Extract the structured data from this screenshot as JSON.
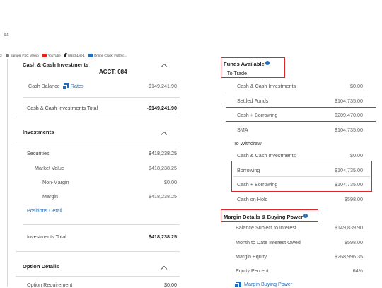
{
  "browser": {
    "top_mark": "L5",
    "bookmark_prefix": "3",
    "bookmarks": [
      {
        "label": "Sample FSC Memo",
        "icon": "globe-icon"
      },
      {
        "label": "YouTube",
        "icon": "youtube-icon"
      },
      {
        "label": "WatchList-1",
        "icon": "watchlist-icon"
      },
      {
        "label": "Online Clock: Full Sc...",
        "icon": "clock-icon"
      }
    ]
  },
  "left": {
    "cash": {
      "title": "Cash & Cash Investments",
      "account": "ACCT: 084",
      "balance_label": "Cash Balance",
      "rates_label": "Rates",
      "balance_value": "-$149,241.90",
      "total_label": "Cash & Cash Investments Total",
      "total_value": "-$149,241.90"
    },
    "investments": {
      "title": "Investments",
      "securities_label": "Securities",
      "securities_value": "$418,238.25",
      "market_value_label": "Market Value",
      "market_value_value": "$418,238.25",
      "non_margin_label": "Non-Margin",
      "non_margin_value": "$0.00",
      "margin_label": "Margin",
      "margin_value": "$418,238.25",
      "positions_detail": "Positions Detail",
      "total_label": "Investments Total",
      "total_value": "$418,238.25"
    },
    "options": {
      "title": "Option Details",
      "requirement_label": "Option Requirement",
      "requirement_value": "$0.00"
    }
  },
  "right": {
    "funds": {
      "title": "Funds Available",
      "to_trade": "To Trade",
      "rows": [
        {
          "label": "Cash & Cash Investments",
          "value": "$0.00"
        },
        {
          "label": "Settled Funds",
          "value": "$104,735.00"
        },
        {
          "label": "Cash + Borrowing",
          "value": "$209,470.00"
        },
        {
          "label": "SMA",
          "value": "$104,735.00"
        }
      ],
      "to_withdraw": "To Withdraw",
      "withdraw_rows": [
        {
          "label": "Cash & Cash Investments",
          "value": "$0.00"
        },
        {
          "label": "Borrowing",
          "value": "$104,735.00"
        },
        {
          "label": "Cash + Borrowing",
          "value": "$104,735.00"
        },
        {
          "label": "Cash on Hold",
          "value": "$598.00"
        }
      ]
    },
    "margin": {
      "title": "Margin Details & Buying Power",
      "rows": [
        {
          "label": "Balance Subject to Interest",
          "value": "$149,839.90"
        },
        {
          "label": "Month to Date Interest Owed",
          "value": "$598.00"
        },
        {
          "label": "Margin Equity",
          "value": "$268,996.35"
        },
        {
          "label": "Equity Percent",
          "value": "64%"
        }
      ],
      "buying_power_link": "Margin Buying Power"
    }
  },
  "colors": {
    "highlight": "#e0262b",
    "link": "#1f6cbf"
  }
}
